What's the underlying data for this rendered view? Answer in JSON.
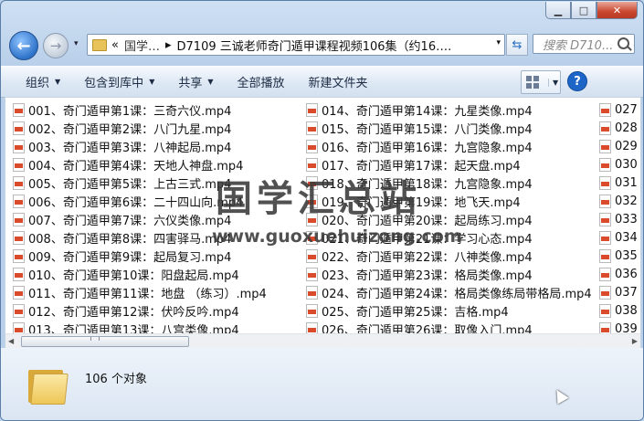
{
  "window": {
    "controls": {
      "minimize": "▁",
      "maximize": "□",
      "close": "✕"
    }
  },
  "nav": {
    "back_icon": "←",
    "forward_icon": "→",
    "history_dropdown": "▾",
    "address_parts": [
      "«",
      "国学…",
      "D7109 三诚老师奇门遁甲课程视频106集（约16…."
    ],
    "address_dropdown": "▾",
    "refresh_icon": "⇆",
    "search_placeholder": "搜索 D710..."
  },
  "toolbar": {
    "items": [
      {
        "label": "组织",
        "has_dropdown": true
      },
      {
        "label": "包含到库中",
        "has_dropdown": true
      },
      {
        "label": "共享",
        "has_dropdown": true
      },
      {
        "label": "全部播放",
        "has_dropdown": false
      },
      {
        "label": "新建文件夹",
        "has_dropdown": false
      }
    ],
    "dropdown_arrow": "▼",
    "help_label": "?"
  },
  "files": {
    "icon": "mp4-file-icon",
    "columns": [
      [
        "001、奇门遁甲第1课：三奇六仪.mp4",
        "002、奇门遁甲第2课：八门九星.mp4",
        "003、奇门遁甲第3课：八神起局.mp4",
        "004、奇门遁甲第4课：天地人神盘.mp4",
        "005、奇门遁甲第5课：上古三式.mp4",
        "006、奇门遁甲第6课：二十四山向.mp4",
        "007、奇门遁甲第7课：六仪类像.mp4",
        "008、奇门遁甲第8课：四害驿马.mp4",
        "009、奇门遁甲第9课：起局复习.mp4",
        "010、奇门遁甲第10课：阳盘起局.mp4",
        "011、奇门遁甲第11课：地盘 （练习）.mp4",
        "012、奇门遁甲第12课：伏吟反吟.mp4",
        "013、奇门遁甲第13课：八宫类像.mp4"
      ],
      [
        "014、奇门遁甲第14课：九星类像.mp4",
        "015、奇门遁甲第15课：八门类像.mp4",
        "016、奇门遁甲第16课：九宫隐象.mp4",
        "017、奇门遁甲第17课：起天盘.mp4",
        "018、奇门遁甲第18课：九宫隐象.mp4",
        "019、奇门遁甲第19课：地飞天.mp4",
        "020、奇门遁甲第20课：起局练习.mp4",
        "021、奇门遁甲第21课：学习心态.mp4",
        "022、奇门遁甲第22课：八神类像.mp4",
        "023、奇门遁甲第23课：格局类像.mp4",
        "024、奇门遁甲第24课：格局类像练局带格局.mp4",
        "025、奇门遁甲第25课：吉格.mp4",
        "026、奇门遁甲第26课：取像入门.mp4"
      ],
      [
        "027",
        "028",
        "029",
        "030",
        "031",
        "032",
        "033",
        "034",
        "035",
        "036",
        "037",
        "038",
        "039"
      ]
    ]
  },
  "scrollbar": {
    "left_arrow": "◀",
    "right_arrow": "▶"
  },
  "status": {
    "count": "106 个对象"
  },
  "watermark": {
    "title": "国学汇总站",
    "url": "www.guoxuehuizong.com"
  }
}
